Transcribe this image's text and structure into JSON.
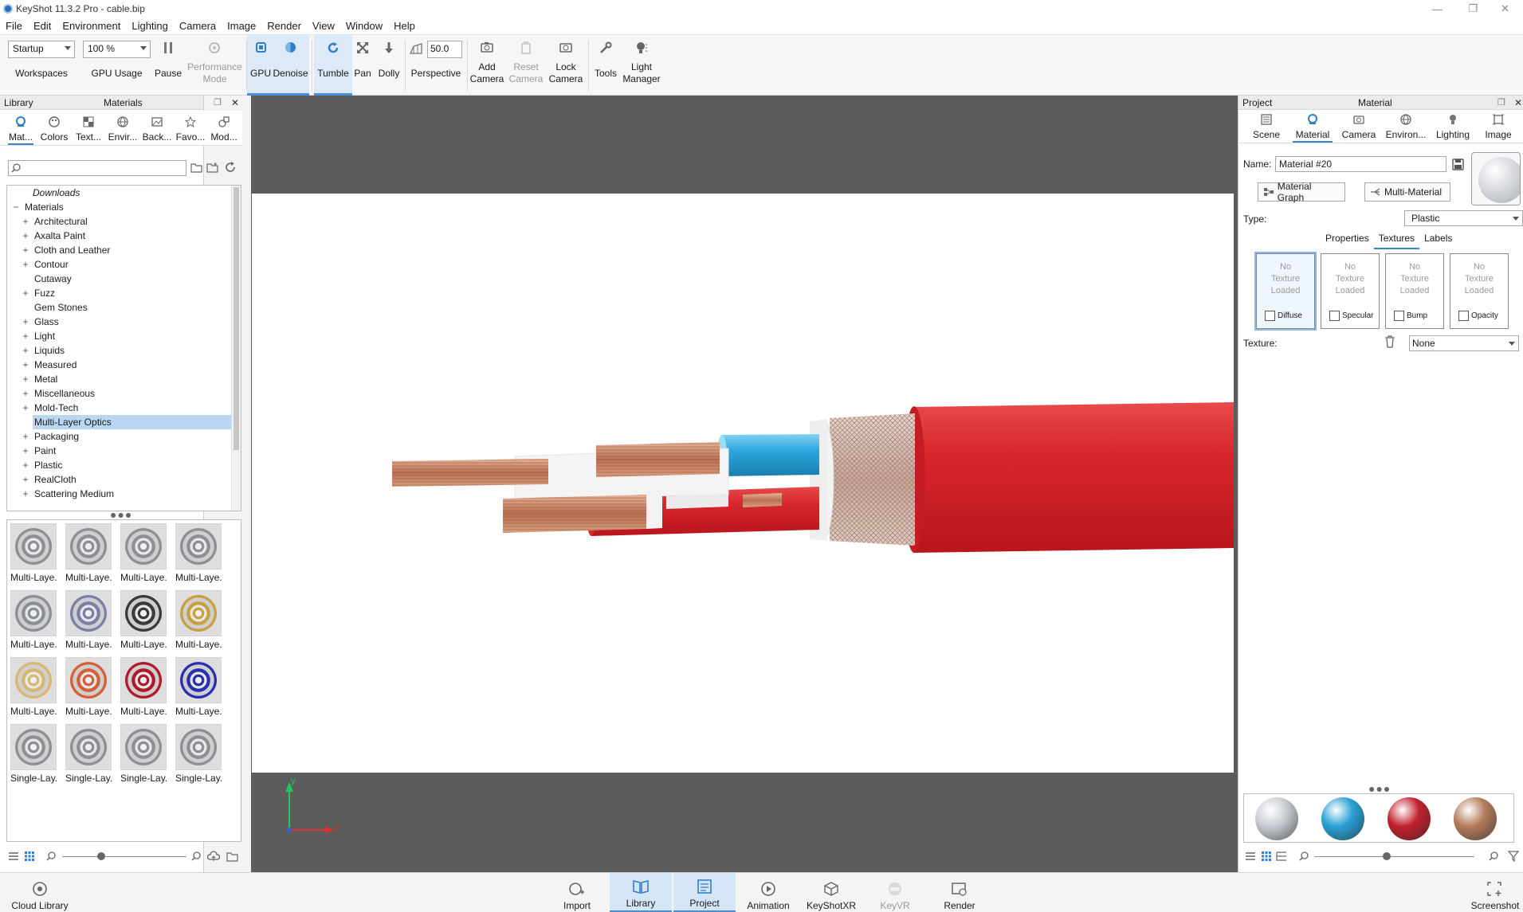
{
  "window": {
    "title": "KeyShot 11.3.2 Pro  -  cable.bip",
    "minimize": "—",
    "restore": "❐",
    "close": "✕"
  },
  "menu": [
    "File",
    "Edit",
    "Environment",
    "Lighting",
    "Camera",
    "Image",
    "Render",
    "View",
    "Window",
    "Help"
  ],
  "toolbar": {
    "workspace_value": "Startup",
    "workspaces_label": "Workspaces",
    "gpu_usage_value": "100 %",
    "gpu_usage_label": "GPU Usage",
    "pause_label": "Pause",
    "perf_mode_line1": "Performance",
    "perf_mode_line2": "Mode",
    "gpu_label": "GPU",
    "denoise_label": "Denoise",
    "tumble_label": "Tumble",
    "pan_label": "Pan",
    "dolly_label": "Dolly",
    "perspective_value": "50.0",
    "perspective_label": "Perspective",
    "add_camera_line1": "Add",
    "add_camera_line2": "Camera",
    "reset_camera_line1": "Reset",
    "reset_camera_line2": "Camera",
    "lock_camera_line1": "Lock",
    "lock_camera_line2": "Camera",
    "tools_label": "Tools",
    "light_manager_line1": "Light",
    "light_manager_line2": "Manager"
  },
  "library": {
    "header_left": "Library",
    "header_center": "Materials",
    "tabs": [
      "Mat...",
      "Colors",
      "Text...",
      "Envir...",
      "Back...",
      "Favo...",
      "Mod..."
    ],
    "search_placeholder": "",
    "tree": [
      {
        "label": "Downloads",
        "pm": "",
        "italic": true
      },
      {
        "label": "Materials",
        "pm": "−",
        "root": true
      },
      {
        "label": "Architectural",
        "pm": "+"
      },
      {
        "label": "Axalta Paint",
        "pm": "+"
      },
      {
        "label": "Cloth and Leather",
        "pm": "+"
      },
      {
        "label": "Contour",
        "pm": "+"
      },
      {
        "label": "Cutaway",
        "pm": ""
      },
      {
        "label": "Fuzz",
        "pm": "+"
      },
      {
        "label": "Gem Stones",
        "pm": ""
      },
      {
        "label": "Glass",
        "pm": "+"
      },
      {
        "label": "Light",
        "pm": "+"
      },
      {
        "label": "Liquids",
        "pm": "+"
      },
      {
        "label": "Measured",
        "pm": "+"
      },
      {
        "label": "Metal",
        "pm": "+"
      },
      {
        "label": "Miscellaneous",
        "pm": "+"
      },
      {
        "label": "Mold-Tech",
        "pm": "+"
      },
      {
        "label": "Multi-Layer Optics",
        "pm": "",
        "selected": true
      },
      {
        "label": "Packaging",
        "pm": "+"
      },
      {
        "label": "Paint",
        "pm": "+"
      },
      {
        "label": "Plastic",
        "pm": "+"
      },
      {
        "label": "RealCloth",
        "pm": "+"
      },
      {
        "label": "Scattering Medium",
        "pm": "+"
      }
    ],
    "thumbs": [
      {
        "label": "Multi-Laye...",
        "color": "#8d8f94"
      },
      {
        "label": "Multi-Laye...",
        "color": "#8d8f94"
      },
      {
        "label": "Multi-Laye...",
        "color": "#8d8f94"
      },
      {
        "label": "Multi-Laye...",
        "color": "#8d8f94"
      },
      {
        "label": "Multi-Laye...",
        "color": "#8a8e95"
      },
      {
        "label": "Multi-Laye...",
        "color": "#7c7fa6"
      },
      {
        "label": "Multi-Laye...",
        "color": "#3a3a3a"
      },
      {
        "label": "Multi-Laye...",
        "color": "#c9a040"
      },
      {
        "label": "Multi-Laye...",
        "color": "#d8b870"
      },
      {
        "label": "Multi-Laye...",
        "color": "#d4603a"
      },
      {
        "label": "Multi-Laye...",
        "color": "#b01a2a"
      },
      {
        "label": "Multi-Laye...",
        "color": "#2a2fb0"
      },
      {
        "label": "Single-Lay...",
        "color": "#8d8f94"
      },
      {
        "label": "Single-Lay...",
        "color": "#8d8f94"
      },
      {
        "label": "Single-Lay...",
        "color": "#8d8f94"
      },
      {
        "label": "Single-Lay...",
        "color": "#8d8f94"
      }
    ]
  },
  "project": {
    "header_left": "Project",
    "header_center": "Material",
    "tabs": [
      "Scene",
      "Material",
      "Camera",
      "Environ...",
      "Lighting",
      "Image"
    ],
    "name_label": "Name:",
    "name_value": "Material #20",
    "material_graph_label": "Material Graph",
    "multi_material_label": "Multi-Material",
    "type_label": "Type:",
    "type_value": "Plastic",
    "subtabs": [
      "Properties",
      "Textures",
      "Labels"
    ],
    "texture_slots": [
      {
        "text1": "No",
        "text2": "Texture",
        "text3": "Loaded",
        "check": "Diffuse"
      },
      {
        "text1": "No",
        "text2": "Texture",
        "text3": "Loaded",
        "check": "Specular"
      },
      {
        "text1": "No",
        "text2": "Texture",
        "text3": "Loaded",
        "check": "Bump"
      },
      {
        "text1": "No",
        "text2": "Texture",
        "text3": "Loaded",
        "check": "Opacity"
      }
    ],
    "texture_label": "Texture:",
    "texture_value": "None",
    "swatches": [
      "#c9ccd2",
      "#2aa0d4",
      "#c2222e",
      "#b47c5c"
    ]
  },
  "bottombar": {
    "cloud_library": "Cloud Library",
    "import": "Import",
    "library": "Library",
    "project": "Project",
    "animation": "Animation",
    "keyshotxr": "KeyShotXR",
    "keyvr": "KeyVR",
    "render": "Render",
    "screenshot": "Screenshot"
  },
  "viewport": {
    "axis_y": "y",
    "axis_x": "x",
    "colors": {
      "background": "#5c5c5c",
      "jacket": "#d52a30",
      "insulation_blue": "#38b3e0",
      "copper": "#c98467"
    }
  }
}
